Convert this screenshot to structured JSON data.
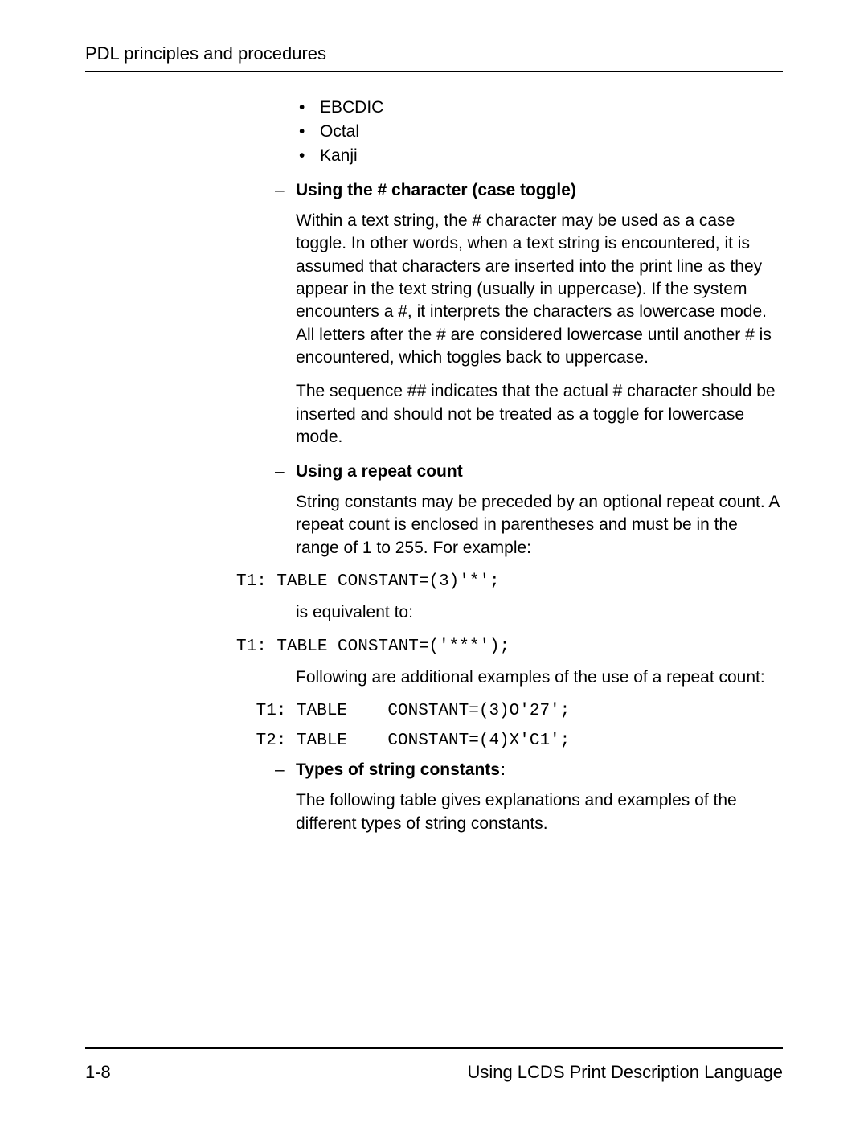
{
  "header": {
    "title": "PDL principles and procedures"
  },
  "bullets": {
    "b1": "EBCDIC",
    "b2": "Octal",
    "b3": "Kanji"
  },
  "section1": {
    "heading": "Using the # character (case toggle)",
    "p1": "Within a text string, the # character may be used as a case toggle. In other words, when a text string is encountered, it is assumed that characters are inserted into the print line as they appear in the text string (usually in uppercase). If the system encounters a #, it interprets the characters as lowercase mode. All letters after the # are considered lowercase until another # is encountered, which toggles back to uppercase.",
    "p2": "The sequence ## indicates that the actual # character should be inserted and should not be treated as a toggle for lowercase mode."
  },
  "section2": {
    "heading": "Using a repeat count",
    "p1": "String constants may be preceded by an optional repeat count. A repeat count is enclosed in parentheses and must be in the range of 1 to 255. For example:",
    "code1": "T1: TABLE CONSTANT=(3)'*';",
    "p2": "is equivalent to:",
    "code2": "T1: TABLE CONSTANT=('***');",
    "p3": "Following are additional examples of the use of a repeat count:",
    "code3a": " T1: TABLE    CONSTANT=(3)O'27';",
    "code3b": " T2: TABLE    CONSTANT=(4)X'C1';"
  },
  "section3": {
    "heading": "Types of string constants:",
    "p1": "The following table gives explanations and examples of the different types of string constants."
  },
  "footer": {
    "left": "1-8",
    "right": "Using LCDS Print Description Language"
  }
}
